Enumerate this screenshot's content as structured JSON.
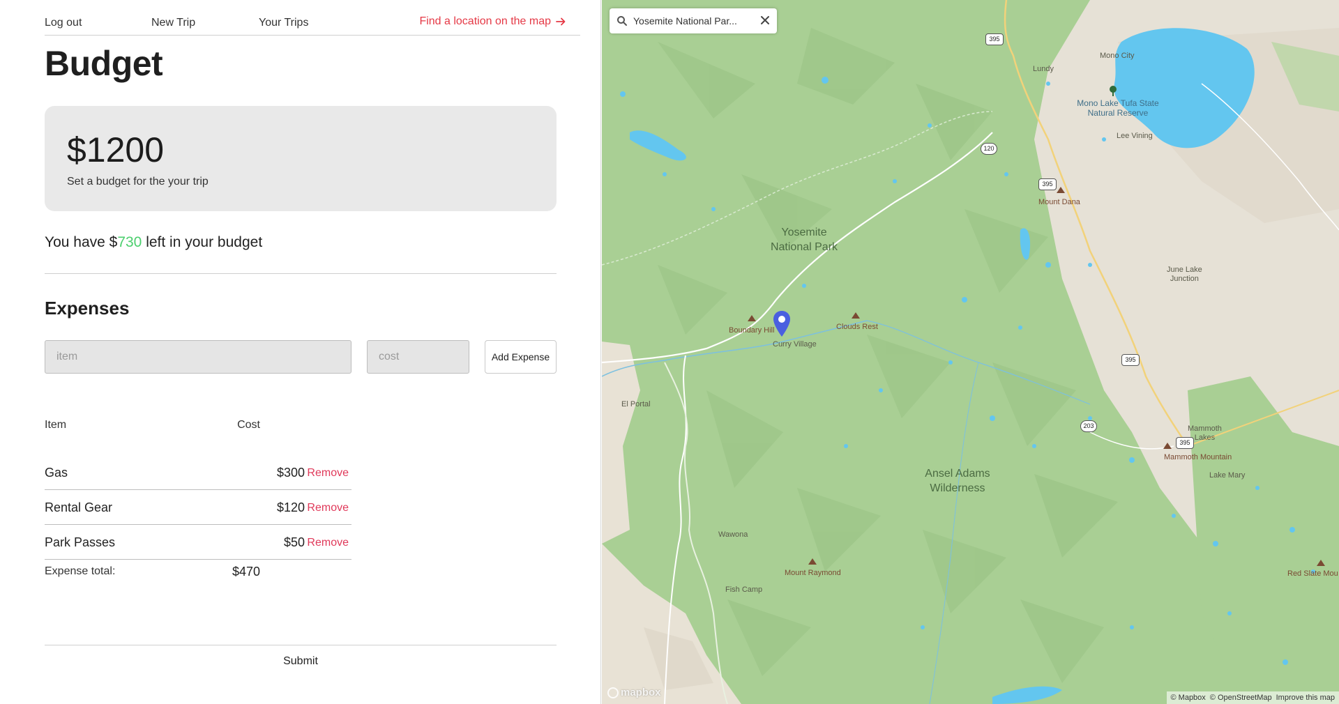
{
  "nav": {
    "logout": "Log out",
    "new_trip": "New Trip",
    "your_trips": "Your Trips",
    "find_location": "Find a location on the map"
  },
  "page": {
    "title": "Budget"
  },
  "budget": {
    "amount": "$1200",
    "subtitle": "Set a budget for the your trip",
    "remaining_prefix": "You have $",
    "remaining_value": "730",
    "remaining_suffix": " left in your budget"
  },
  "expenses": {
    "heading": "Expenses",
    "item_placeholder": "item",
    "cost_placeholder": "cost",
    "add_label": "Add Expense",
    "col_item": "Item",
    "col_cost": "Cost",
    "remove_label": "Remove",
    "rows": [
      {
        "name": "Gas",
        "cost": "$300"
      },
      {
        "name": "Rental Gear",
        "cost": "$120"
      },
      {
        "name": "Park Passes",
        "cost": "$50"
      }
    ],
    "total_label": "Expense total:",
    "total_value": "$470",
    "submit_label": "Submit"
  },
  "map": {
    "search_value": "Yosemite National Par...",
    "labels": {
      "mono_city": "Mono City",
      "lundy": "Lundy",
      "mono_lake": "Mono Lake Tufa State Natural Reserve",
      "lee_vining": "Lee Vining",
      "mount_dana": "Mount Dana",
      "yosemite_np_1": "Yosemite",
      "yosemite_np_2": "National Park",
      "june_lake_1": "June Lake",
      "june_lake_2": "Junction",
      "boundary_hill": "Boundary Hill",
      "curry_village": "Curry Village",
      "clouds_rest": "Clouds Rest",
      "el_portal": "El Portal",
      "mammoth_lakes_1": "Mammoth",
      "mammoth_lakes_2": "Lakes",
      "mammoth_mountain": "Mammoth Mountain",
      "lake_mary": "Lake Mary",
      "ansel_adams_1": "Ansel Adams",
      "ansel_adams_2": "Wilderness",
      "wawona": "Wawona",
      "mount_raymond": "Mount Raymond",
      "fish_camp": "Fish Camp",
      "red_slate": "Red Slate Mou"
    },
    "shields": {
      "us395_a": "395",
      "ca120": "120",
      "us395_b": "395",
      "us395_c": "395",
      "ca203": "203",
      "us395_d": "395"
    },
    "logo": "mapbox",
    "attribution": {
      "mapbox": "© Mapbox",
      "osm": "© OpenStreetMap",
      "improve": "Improve this map"
    }
  },
  "colors": {
    "accent_red": "#e53946",
    "remove_red": "#e0395a",
    "remaining_green": "#4ccf6e",
    "card_bg": "#e9e9e9",
    "map_green": "#a9cf94",
    "water": "#63c6ef",
    "pin": "#4a5fe0"
  }
}
